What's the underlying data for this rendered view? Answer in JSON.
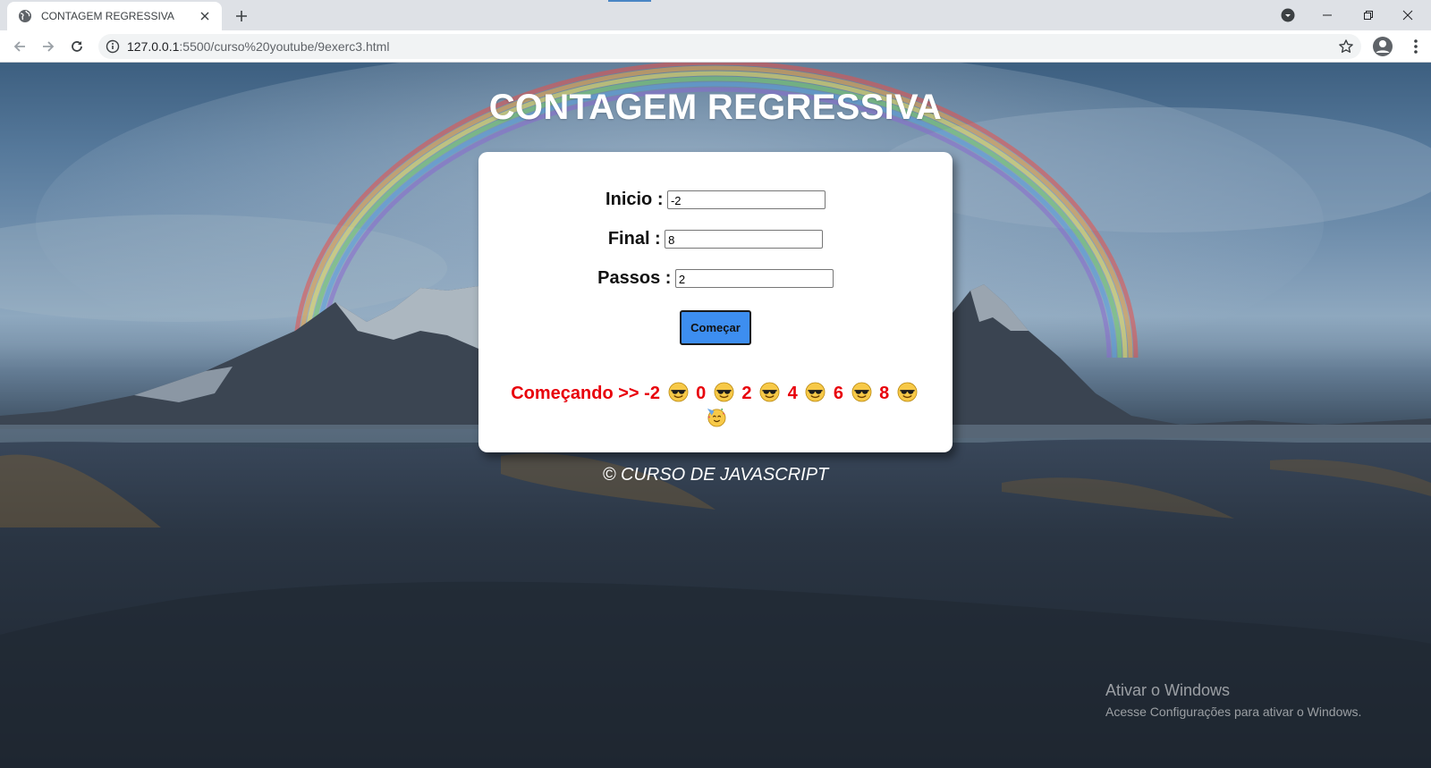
{
  "browser": {
    "tab_title": "CONTAGEM REGRESSIVA",
    "url_host": "127.0.0.1",
    "url_rest": ":5500/curso%20youtube/9exerc3.html"
  },
  "page": {
    "title": "CONTAGEM REGRESSIVA",
    "form": {
      "inicio_label": "Inicio :",
      "inicio_value": "-2",
      "final_label": "Final :",
      "final_value": "8",
      "passos_label": "Passos :",
      "passos_value": "2",
      "button_label": "Começar"
    },
    "result": {
      "prefix": "Começando >>",
      "values": [
        "-2",
        "0",
        "2",
        "4",
        "6",
        "8"
      ],
      "step_emoji": "smiling-face-with-sunglasses-icon",
      "end_emoji": "partying-face-icon"
    },
    "footer": "© CURSO DE JAVASCRIPT"
  },
  "os_watermark": {
    "title": "Ativar o Windows",
    "subtitle": "Acesse Configurações para ativar o Windows."
  },
  "colors": {
    "result_text": "#e8000b",
    "button_bg": "#3d8ef0",
    "card_bg": "#ffffff"
  }
}
